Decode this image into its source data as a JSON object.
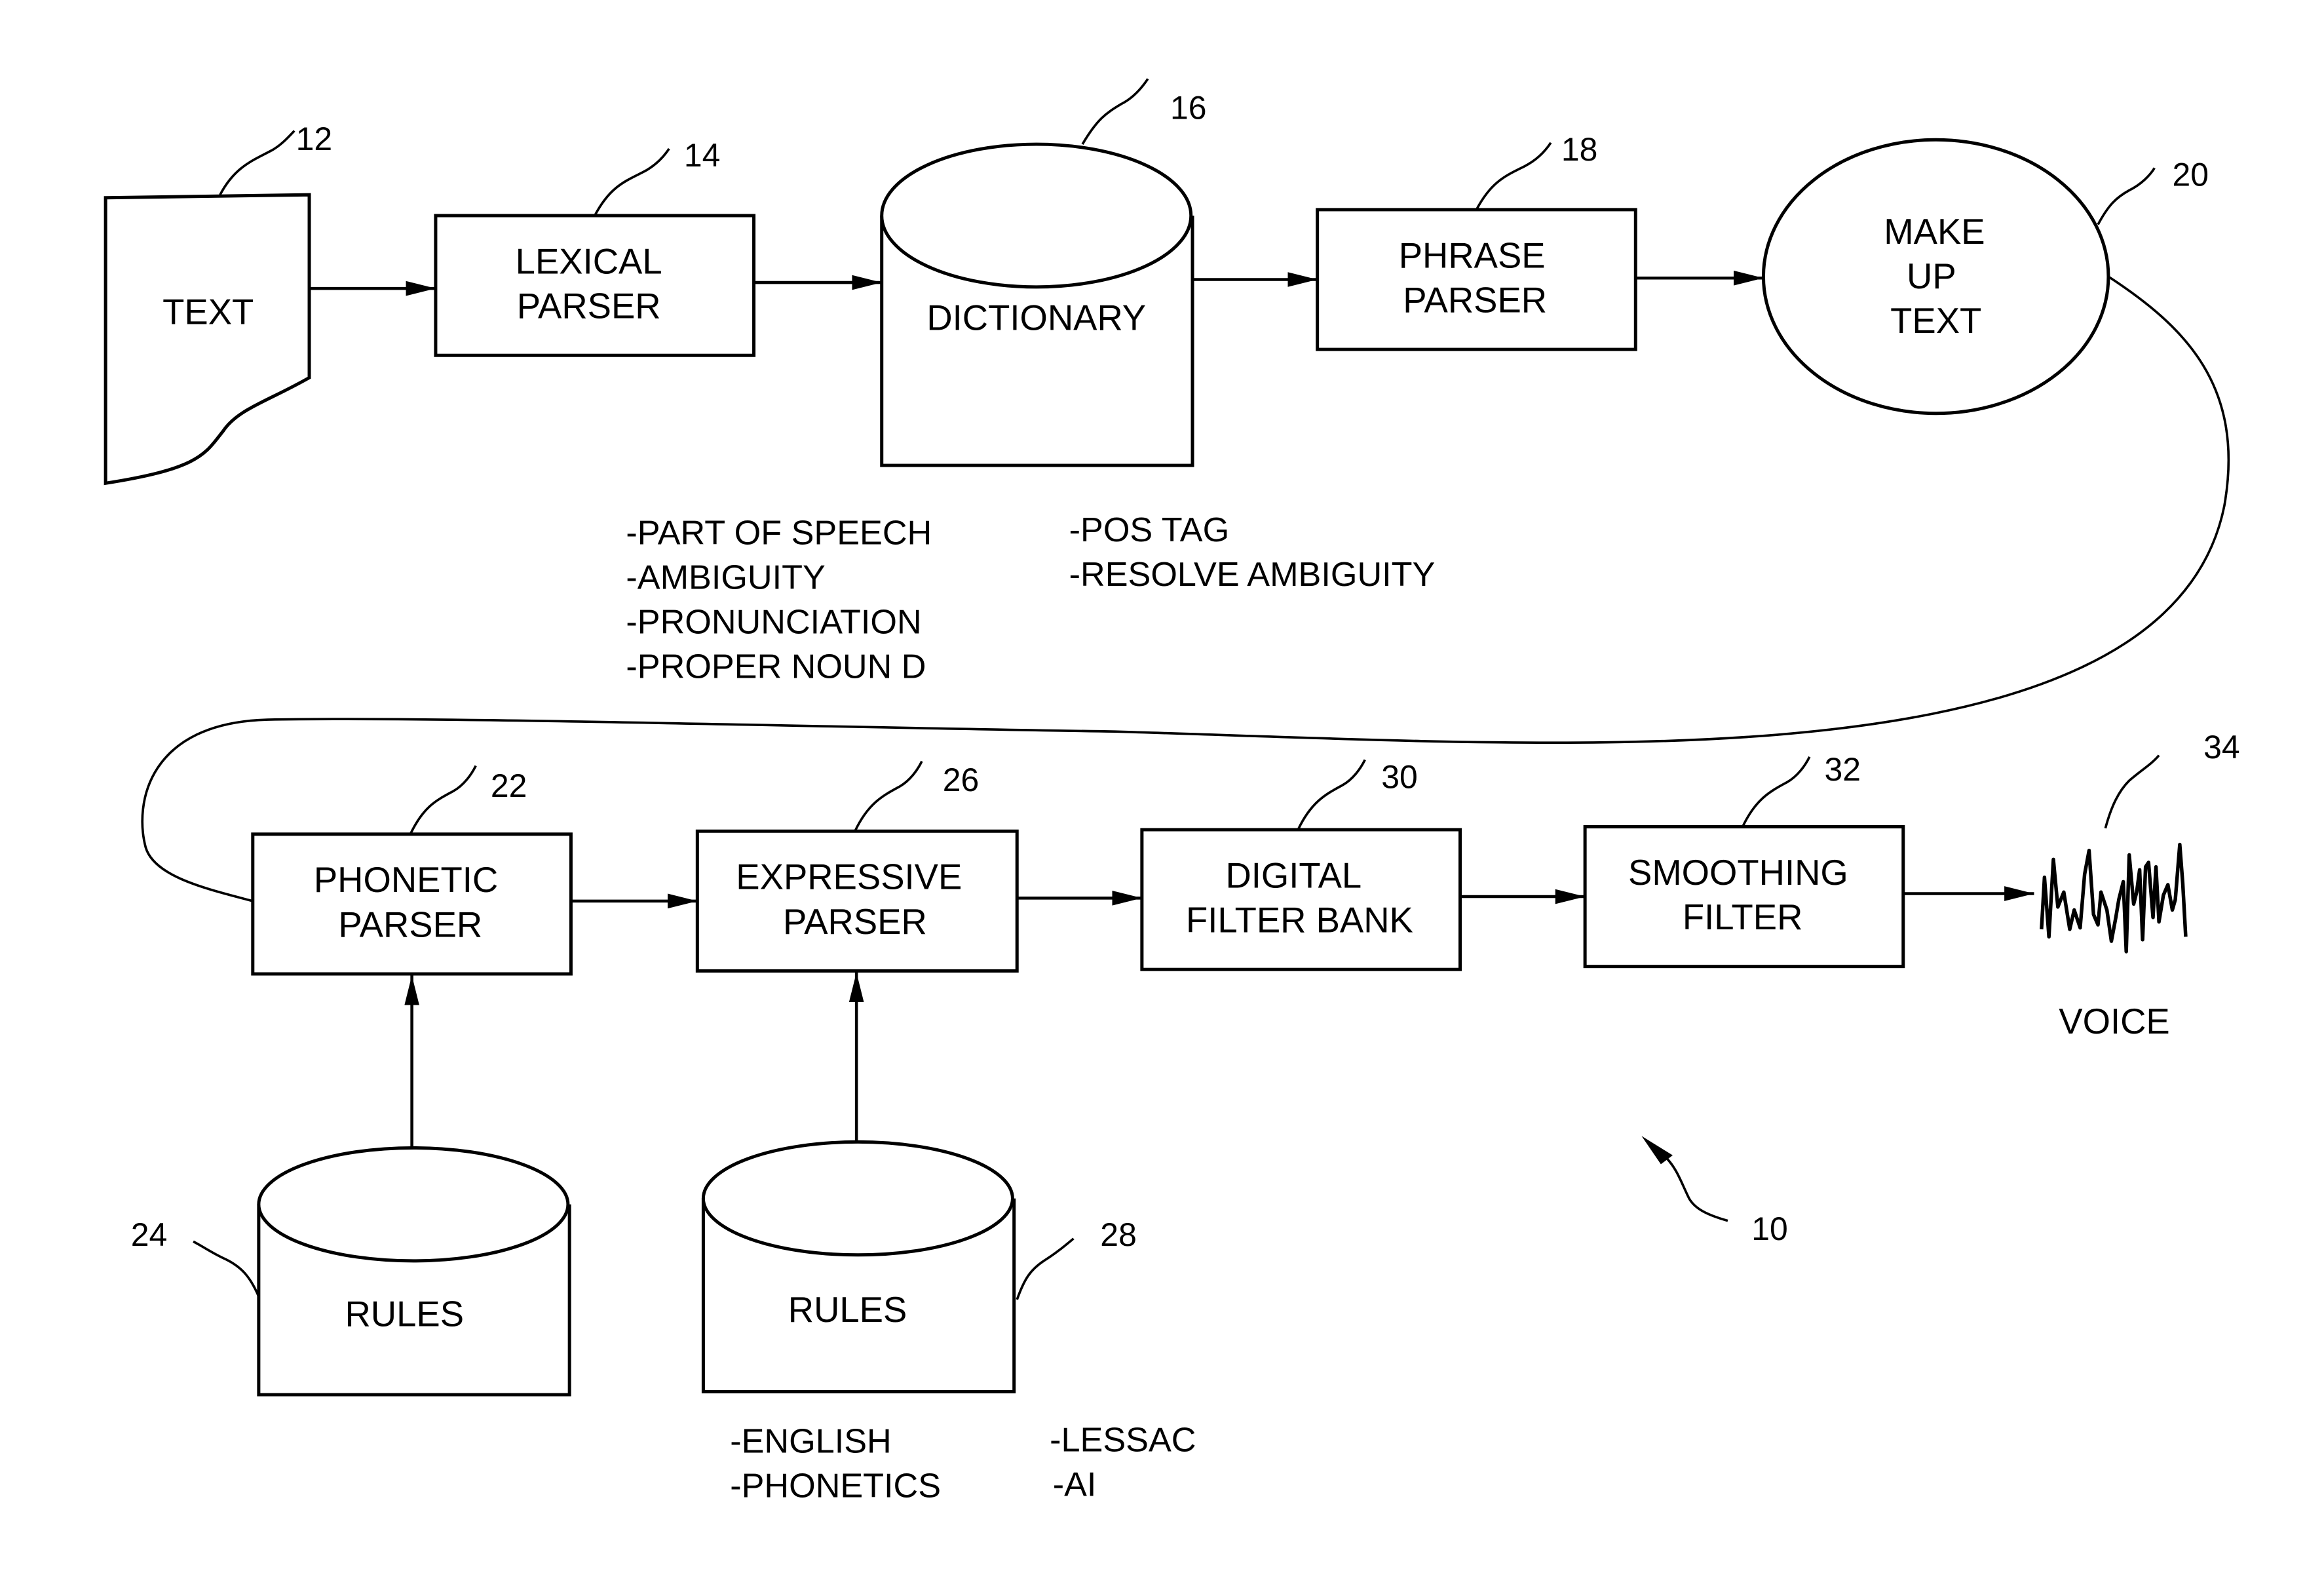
{
  "figure": {
    "reference_numeral": "10",
    "colors": {
      "ink": "#000000",
      "background": "#ffffff"
    }
  },
  "nodes": {
    "text": {
      "ref": "12",
      "lines": [
        "TEXT"
      ]
    },
    "lexical_parser": {
      "ref": "14",
      "lines": [
        "LEXICAL",
        "PARSER"
      ]
    },
    "dictionary": {
      "ref": "16",
      "lines": [
        "DICTIONARY"
      ]
    },
    "phrase_parser": {
      "ref": "18",
      "lines": [
        "PHRASE",
        "PARSER"
      ]
    },
    "make_up_text": {
      "ref": "20",
      "lines": [
        "MAKE",
        "UP",
        "TEXT"
      ]
    },
    "phonetic_parser": {
      "ref": "22",
      "lines": [
        "PHONETIC",
        "PARSER"
      ]
    },
    "phonetic_rules": {
      "ref": "24",
      "lines": [
        "RULES"
      ]
    },
    "expressive_parser": {
      "ref": "26",
      "lines": [
        "EXPRESSIVE",
        "PARSER"
      ]
    },
    "expressive_rules": {
      "ref": "28",
      "lines": [
        "RULES"
      ]
    },
    "digital_filter_bank": {
      "ref": "30",
      "lines": [
        "DIGITAL",
        "FILTER BANK"
      ]
    },
    "smoothing_filter": {
      "ref": "32",
      "lines": [
        "SMOOTHING",
        "FILTER"
      ]
    },
    "voice": {
      "ref": "34",
      "label": "VOICE"
    }
  },
  "annotations": {
    "dictionary_notes": [
      "-PART OF SPEECH",
      "-AMBIGUITY",
      "-PRONUNCIATION",
      "-PROPER NOUN D"
    ],
    "phrase_notes": [
      "-POS TAG",
      "-RESOLVE AMBIGUITY"
    ],
    "rules_notes_left": [
      "-ENGLISH",
      "-PHONETICS"
    ],
    "rules_notes_right": [
      "-LESSAC",
      "-AI"
    ]
  }
}
